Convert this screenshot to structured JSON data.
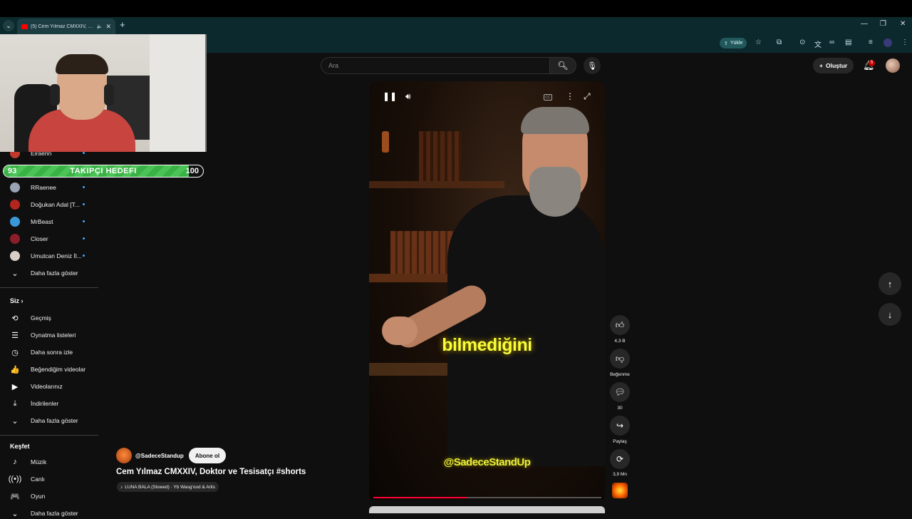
{
  "browser": {
    "tab_title": "(5) Cem Yılmaz CMXXIV, Do",
    "new_tab": "+",
    "upload_label": "Yükle"
  },
  "overlay": {
    "goal": {
      "current": "93",
      "label": "TAKIPÇI HEDEFI",
      "target": "100",
      "progress": 0.93
    }
  },
  "sidebar": {
    "subscriptions": [
      {
        "label": "Eiraenn",
        "color": "#c0392b"
      },
      {
        "label": "RRaenee",
        "color": "#9aa4b2"
      },
      {
        "label": "Doğukan Adal [T...",
        "color": "#b3261e"
      },
      {
        "label": "MrBeast",
        "color": "#3a9ad9"
      },
      {
        "label": "Closer",
        "color": "#8b1e2b"
      },
      {
        "label": "Umutcan Deniz İl...",
        "color": "#d9cfc7"
      }
    ],
    "subs_more": "Daha fazla göster",
    "you_header": "Siz",
    "you_items": [
      {
        "label": "Geçmiş",
        "icon": "history-icon"
      },
      {
        "label": "Oynatma listeleri",
        "icon": "playlist-icon"
      },
      {
        "label": "Daha sonra izle",
        "icon": "clock-icon"
      },
      {
        "label": "Beğendiğim videolar",
        "icon": "thumbs-up-icon"
      },
      {
        "label": "Videolarınız",
        "icon": "video-icon"
      },
      {
        "label": "İndirilenler",
        "icon": "download-icon"
      }
    ],
    "you_more": "Daha fazla göster",
    "explore_header": "Keşfet",
    "explore_items": [
      {
        "label": "Müzik",
        "icon": "music-icon"
      },
      {
        "label": "Canlı",
        "icon": "live-icon"
      },
      {
        "label": "Oyun",
        "icon": "gamepad-icon"
      }
    ],
    "explore_more": "Daha fazla göster"
  },
  "header": {
    "search_placeholder": "Ara",
    "create_label": "Oluştur",
    "notification_count": "5"
  },
  "video": {
    "caption_main": "bilmediğini",
    "caption_handle": "@SadeceStandUp",
    "progress": 0.41
  },
  "actions": {
    "likes": "4,3 B",
    "dislike": "Beğenme",
    "comments": "30",
    "share": "Paylaş",
    "remix": "3,9 Mn"
  },
  "meta": {
    "channel": "@SadeceStandup",
    "subscribe": "Abone ol",
    "title": "Cem Yılmaz CMXXIV, Doktor ve Tesisatçı #shorts",
    "music": "LUNA BALA (Slowed) · Yb Wasg'ood & Arlis"
  },
  "colors": {
    "accent": "#ff0033",
    "goal_fill": "#4cc357",
    "caption": "#f5ff3a"
  }
}
